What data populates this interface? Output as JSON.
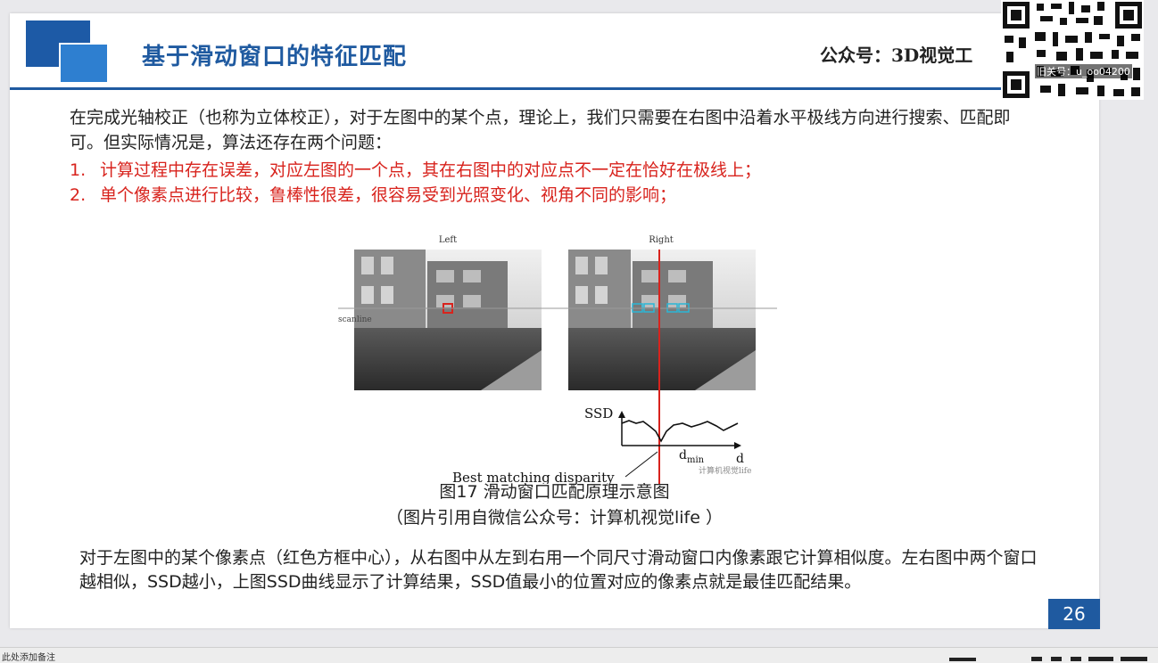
{
  "slide": {
    "title": "基于滑动窗口的特征匹配",
    "brand": "公众号：3D视觉工",
    "qr_caption": "旧关号：u_oo04200",
    "intro": "在完成光轴校正（也称为立体校正），对于左图中的某个点，理论上，我们只需要在右图中沿着水平极线方向进行搜索、匹配即可。但实际情况是，算法还存在两个问题：",
    "issues": [
      {
        "num": "1.",
        "text": "计算过程中存在误差，对应左图的一个点，其在右图中的对应点不一定在恰好在极线上；"
      },
      {
        "num": "2.",
        "text": "单个像素点进行比较，鲁棒性很差，很容易受到光照变化、视角不同的影响；"
      }
    ],
    "figure": {
      "left_label": "Left",
      "right_label": "Right",
      "scanline_label": "scanline",
      "ssd_label": "SSD",
      "dmin_label": "d",
      "dmin_sub": "min",
      "d_label": "d",
      "best_label": "Best matching disparity",
      "watermark": "计算机视觉life"
    },
    "caption_main": "图17 滑动窗口匹配原理示意图",
    "caption_source": "（图片引用自微信公众号：计算机视觉life ）",
    "explanation": "对于左图中的某个像素点（红色方框中心），从右图中从左到右用一个同尺寸滑动窗口内像素跟它计算相似度。左右图中两个窗口越相似，SSD越小，上图SSD曲线显示了计算结果，SSD值最小的位置对应的像素点就是最佳匹配结果。",
    "page_number": "26"
  },
  "notes": {
    "placeholder": "此处添加备注"
  },
  "colors": {
    "accent": "#1f5aa0",
    "issue_red": "#d8231d",
    "match_line": "#d8231d",
    "window_cyan": "#2bb6d6"
  }
}
